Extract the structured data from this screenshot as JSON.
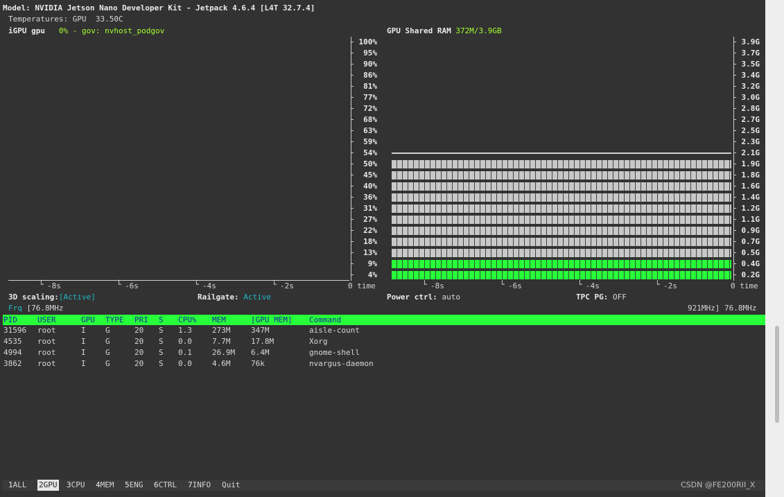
{
  "header": {
    "model_line": "Model: NVIDIA Jetson Nano Developer Kit - Jetpack 4.6.4 [L4T 32.7.4]",
    "temperatures": "Temperatures: GPU  33.50C"
  },
  "gpu_panel": {
    "label": "iGPU gpu",
    "load": "0%",
    "gov_prefix": " - gov: ",
    "gov": "nvhost_podgov",
    "y_ticks": [
      "100%",
      "95%",
      "90%",
      "86%",
      "81%",
      "77%",
      "72%",
      "68%",
      "63%",
      "59%",
      "54%",
      "50%",
      "45%",
      "40%",
      "36%",
      "31%",
      "27%",
      "22%",
      "18%",
      "13%",
      "9%",
      "4%"
    ],
    "x_ticks": [
      "-8s",
      "-6s",
      "-4s",
      "-2s"
    ],
    "x_unit": "0 time"
  },
  "ram_panel": {
    "label": "GPU Shared RAM ",
    "value": "372M/3.9GB",
    "y_ticks": [
      "3.9G",
      "3.7G",
      "3.5G",
      "3.4G",
      "3.2G",
      "3.0G",
      "2.8G",
      "2.7G",
      "2.5G",
      "2.3G",
      "2.1G",
      "1.9G",
      "1.8G",
      "1.6G",
      "1.4G",
      "1.2G",
      "1.1G",
      "0.9G",
      "0.7G",
      "0.5G",
      "0.4G",
      "0.2G"
    ],
    "x_ticks": [
      "-8s",
      "-6s",
      "-4s",
      "-2s"
    ],
    "x_unit": "0 time",
    "total_level_gb": 2.1,
    "used_level_gb": 0.4,
    "colors": {
      "total": "#c8c8c8",
      "used": "#27ff3a"
    }
  },
  "status": {
    "scaling_label": "3D scaling:",
    "scaling_value": "[Active]",
    "railgate_label": "Railgate: ",
    "railgate_value": "Active",
    "power_label": "Power ctrl: ",
    "power_value": "auto",
    "tpc_label": "TPC PG: ",
    "tpc_value": "OFF",
    "frq_label": "Frq",
    "frq_value": " [76.8MHz",
    "frq_right": "921MHz] 76.8MHz"
  },
  "table": {
    "headers": [
      "PID",
      "USER",
      "GPU",
      "TYPE",
      "PRI",
      "S",
      "CPU%",
      "MEM",
      "[GPU MEM]",
      "Command"
    ],
    "rows": [
      [
        "31596",
        "root",
        "I",
        "G",
        "20",
        "S",
        "1.3",
        "273M",
        "347M",
        "aisle-count"
      ],
      [
        "4535",
        "root",
        "I",
        "G",
        "20",
        "S",
        "0.0",
        "7.7M",
        "17.8M",
        "Xorg"
      ],
      [
        "4994",
        "root",
        "I",
        "G",
        "20",
        "S",
        "0.1",
        "26.9M",
        "6.4M",
        "gnome-shell"
      ],
      [
        "3862",
        "root",
        "I",
        "G",
        "20",
        "S",
        "0.0",
        "4.6M",
        "76k",
        "nvargus-daemon"
      ]
    ]
  },
  "tabs": [
    {
      "num": "1",
      "label": "ALL"
    },
    {
      "num": "2",
      "label": "GPU"
    },
    {
      "num": "3",
      "label": "CPU"
    },
    {
      "num": "4",
      "label": "MEM"
    },
    {
      "num": "5",
      "label": "ENG"
    },
    {
      "num": "6",
      "label": "CTRL"
    },
    {
      "num": "7",
      "label": "INFO"
    },
    {
      "num": "",
      "label": "Quit"
    }
  ],
  "active_tab": 1,
  "watermark": "CSDN @FE200RII_X"
}
